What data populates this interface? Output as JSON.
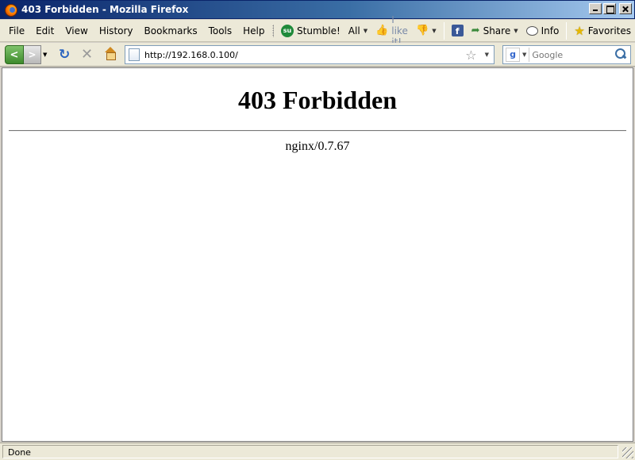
{
  "window": {
    "title": "403 Forbidden - Mozilla Firefox"
  },
  "menu": {
    "items": [
      {
        "label": "File"
      },
      {
        "label": "Edit"
      },
      {
        "label": "View"
      },
      {
        "label": "History"
      },
      {
        "label": "Bookmarks"
      },
      {
        "label": "Tools"
      },
      {
        "label": "Help"
      }
    ]
  },
  "toolbar": {
    "stumble_label": "Stumble!",
    "all_label": "All",
    "ilike_label": "I like it!",
    "share_label": "Share",
    "info_label": "Info",
    "favorites_label": "Favorites"
  },
  "nav": {
    "url": "http://192.168.0.100/",
    "search_placeholder": "Google"
  },
  "page": {
    "heading": "403 Forbidden",
    "server": "nginx/0.7.67"
  },
  "status": {
    "text": "Done"
  },
  "colors": {
    "titlebar_start": "#0a246a",
    "titlebar_end": "#a6caf0",
    "chrome": "#ece9d8"
  }
}
